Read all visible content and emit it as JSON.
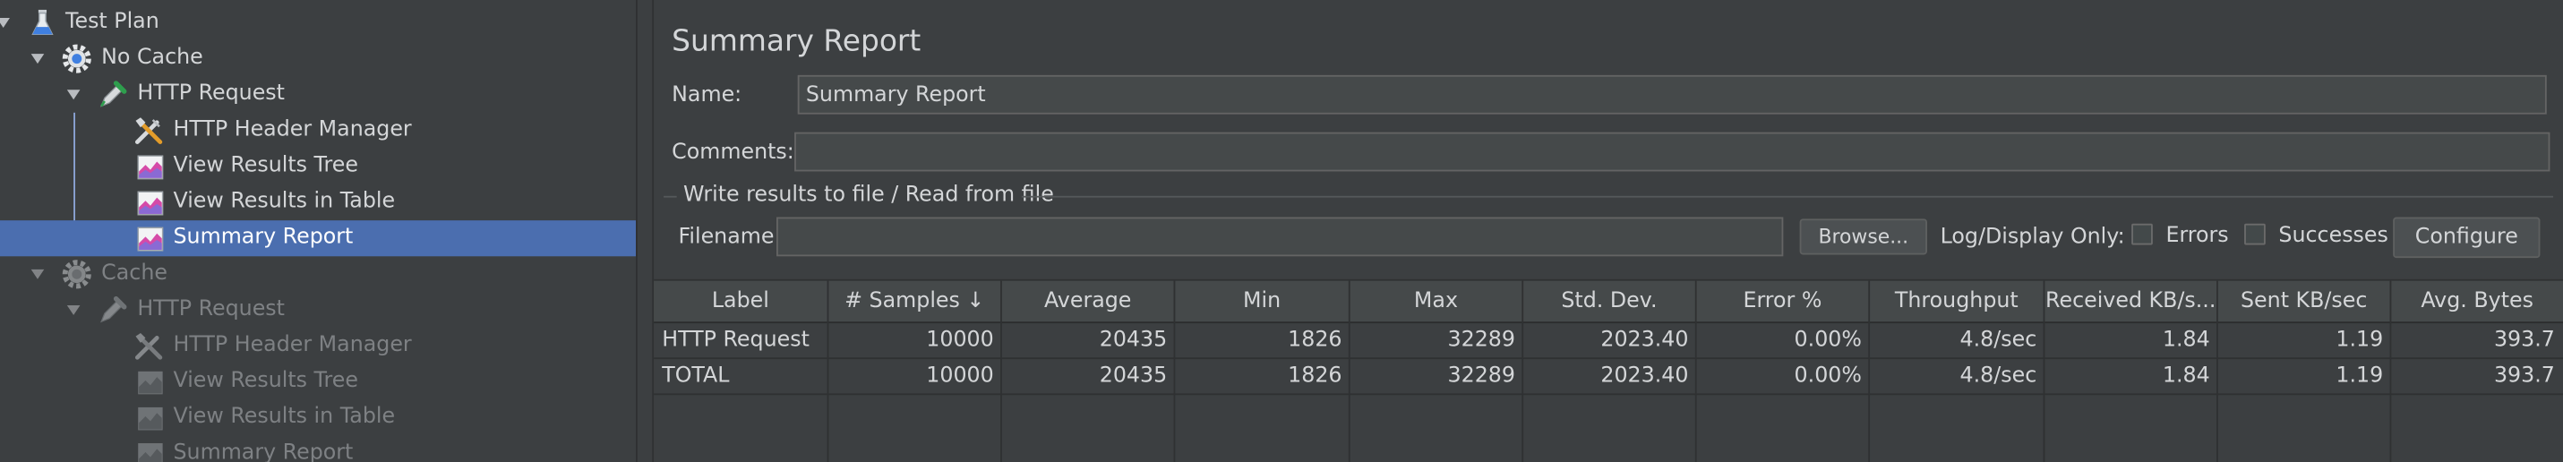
{
  "tree": {
    "items": [
      {
        "label": "Test Plan",
        "icon": "flask-icon"
      },
      {
        "label": "No Cache",
        "icon": "gear-icon"
      },
      {
        "label": "HTTP Request",
        "icon": "pipette-icon"
      },
      {
        "label": "HTTP Header Manager",
        "icon": "tools-icon"
      },
      {
        "label": "View Results Tree",
        "icon": "graph-icon"
      },
      {
        "label": "View Results in Table",
        "icon": "graph-icon"
      },
      {
        "label": "Summary Report",
        "icon": "graph-icon",
        "selected": true
      },
      {
        "label": "Cache",
        "icon": "gear-icon",
        "disabled": true
      },
      {
        "label": "HTTP Request",
        "icon": "pipette-icon",
        "disabled": true
      },
      {
        "label": "HTTP Header Manager",
        "icon": "tools-icon",
        "disabled": true
      },
      {
        "label": "View Results Tree",
        "icon": "graph-icon",
        "disabled": true
      },
      {
        "label": "View Results in Table",
        "icon": "graph-icon",
        "disabled": true
      },
      {
        "label": "Summary Report",
        "icon": "graph-icon",
        "disabled": true
      }
    ]
  },
  "panel": {
    "title": "Summary Report",
    "name_label": "Name:",
    "name_value": "Summary Report",
    "comments_label": "Comments:",
    "comments_value": "",
    "file_group_title": "Write results to file / Read from file",
    "filename_label": "Filename",
    "filename_value": "",
    "browse_label": "Browse...",
    "log_display_label": "Log/Display Only:",
    "errors_label": "Errors",
    "successes_label": "Successes",
    "configure_label": "Configure"
  },
  "table": {
    "headers": [
      "Label",
      "# Samples ↓",
      "Average",
      "Min",
      "Max",
      "Std. Dev.",
      "Error %",
      "Throughput",
      "Received KB/s...",
      "Sent KB/sec",
      "Avg. Bytes"
    ],
    "rows": [
      [
        "HTTP Request",
        "10000",
        "20435",
        "1826",
        "32289",
        "2023.40",
        "0.00%",
        "4.8/sec",
        "1.84",
        "1.19",
        "393.7"
      ],
      [
        "TOTAL",
        "10000",
        "20435",
        "1826",
        "32289",
        "2023.40",
        "0.00%",
        "4.8/sec",
        "1.84",
        "1.19",
        "393.7"
      ]
    ]
  },
  "colors": {
    "background": "#3c3f41",
    "selection": "#4b6eaf",
    "text": "#d4d6d8",
    "disabled_text": "#7e8184"
  }
}
